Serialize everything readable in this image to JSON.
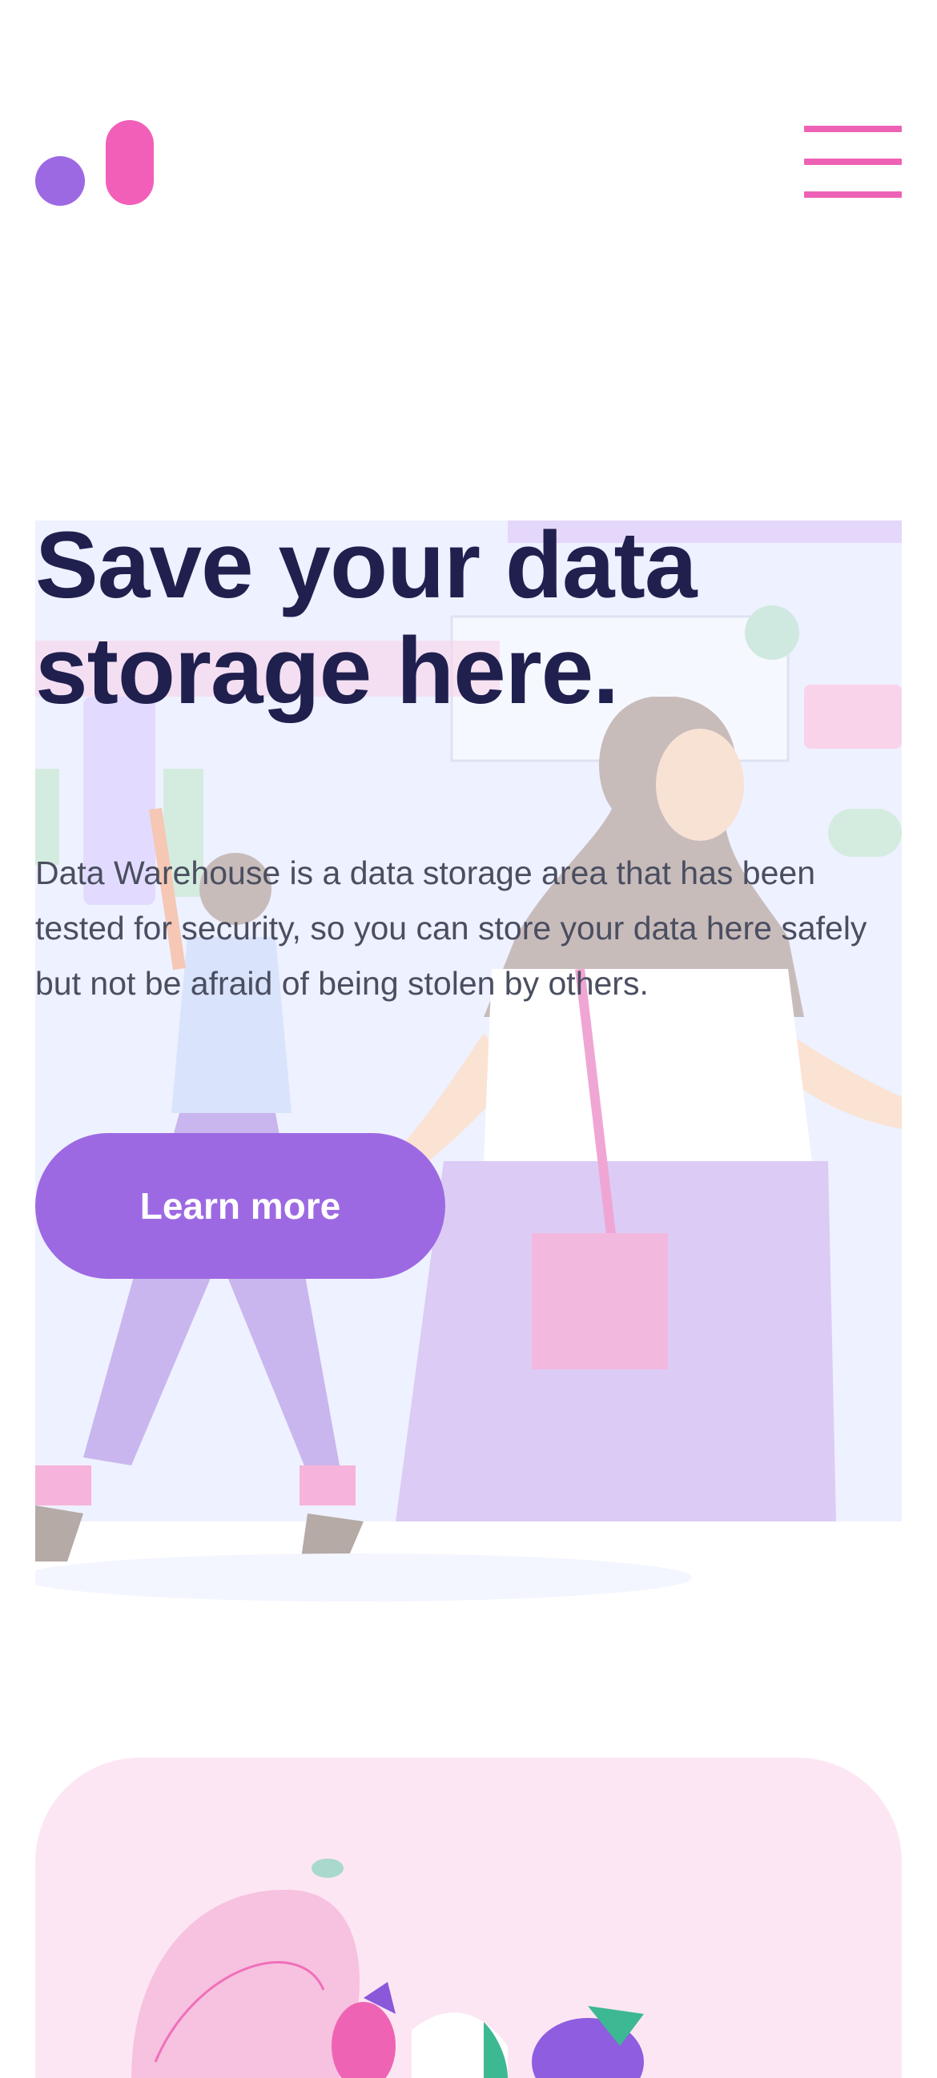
{
  "header": {
    "logo_name": "logo-icon",
    "menu_icon": "hamburger-menu-icon",
    "colors": {
      "logo_dot": "#9d69e3",
      "logo_pill": "#f25fb9",
      "menu": "#ee62b5"
    }
  },
  "hero": {
    "title": "Save your data storage here.",
    "description": "Data Warehouse is a data storage area that has been tested for security, so you can store your data here safely but not be afraid of being stolen by others.",
    "cta_label": "Learn more",
    "colors": {
      "title": "#20204f",
      "text": "#4a4e60",
      "accent": "#9d69e3"
    }
  },
  "feature": {
    "colors": {
      "card_bg": "#fde6f3"
    }
  }
}
